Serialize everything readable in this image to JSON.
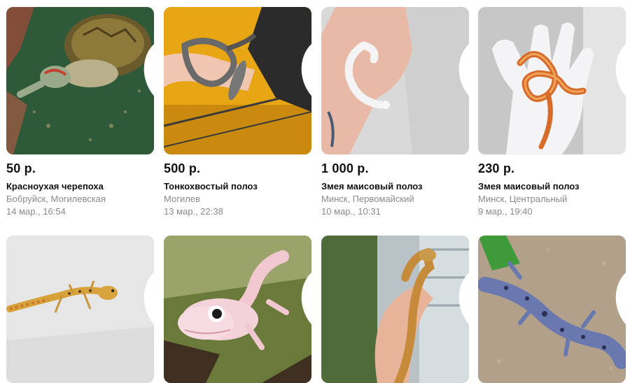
{
  "listings": [
    {
      "price": "50 р.",
      "title": "Красноухая черепоха",
      "location": "Бобруйск, Могилевская",
      "date": "14 мар., 16:54",
      "image": "red-eared-turtle"
    },
    {
      "price": "500 р.",
      "title": "Тонкохвостый полоз",
      "location": "Могилев",
      "date": "13 мар., 22:38",
      "image": "snake-on-arm"
    },
    {
      "price": "1 000 р.",
      "title": "Змея маисовый полоз",
      "location": "Минск, Первомайский",
      "date": "10 мар., 10:31",
      "image": "white-corn-snake"
    },
    {
      "price": "230 р.",
      "title": "Змея маисовый полоз",
      "location": "Минск, Центральный",
      "date": "9 мар., 19:40",
      "image": "orange-corn-snake"
    },
    {
      "image": "leopard-gecko"
    },
    {
      "image": "white-gecko"
    },
    {
      "image": "bearded-dragon"
    },
    {
      "image": "blue-gecko"
    }
  ],
  "colors": {
    "price": "#111111",
    "meta": "#8a8a8a",
    "heart": "#ffffff"
  },
  "icons": {
    "favorite": "heart-outline-icon"
  }
}
